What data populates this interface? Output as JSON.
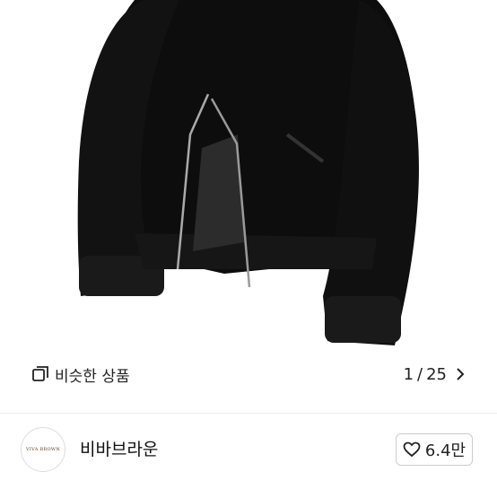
{
  "similar_products": {
    "label": "비슷한 상품"
  },
  "gallery": {
    "current": "1",
    "separator": "/",
    "total": "25"
  },
  "shop": {
    "logo_text": "VIVA BROWN",
    "name": "비바브라운"
  },
  "likes": {
    "count": "6.4만"
  },
  "icons": {
    "similar": "copy-icon",
    "next": "chevron-right-icon",
    "like": "heart-outline-icon"
  }
}
